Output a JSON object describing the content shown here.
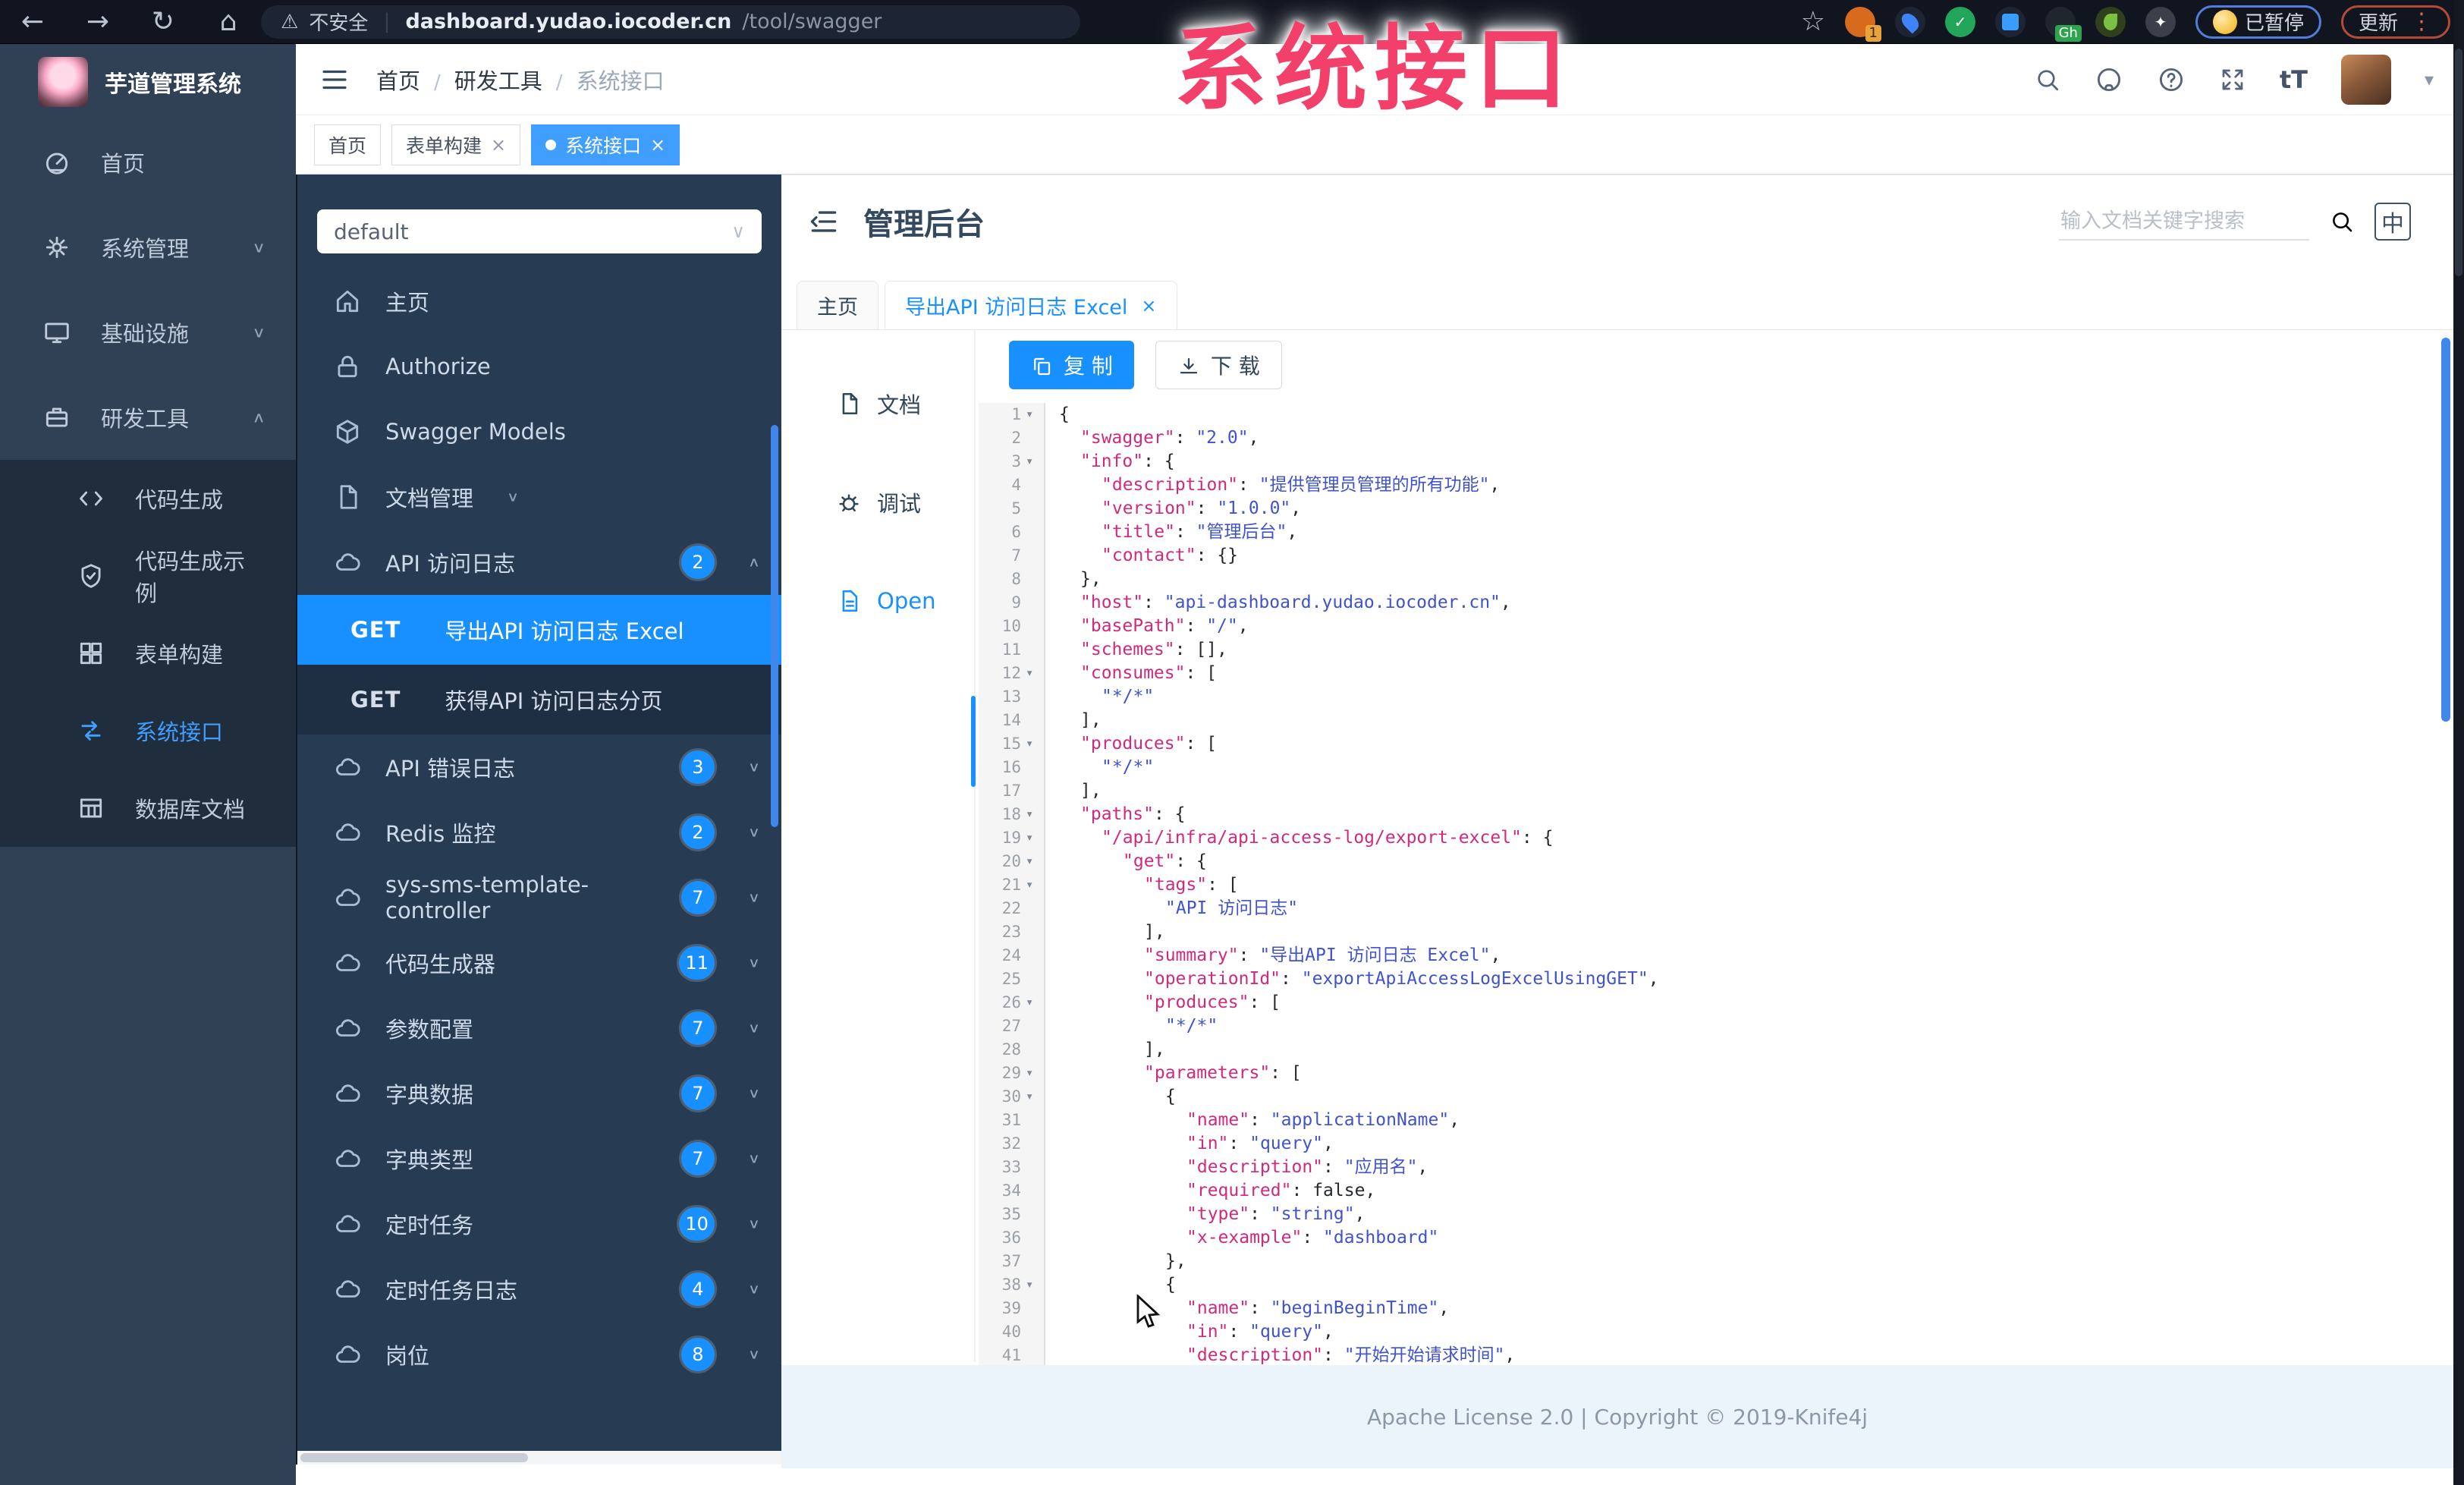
{
  "watermark": "系统接口",
  "browser": {
    "back_icon": "←",
    "forward_icon": "→",
    "reload_icon": "↻",
    "home_icon": "⌂",
    "warning_icon": "⚠",
    "security_label": "不安全",
    "url_host": "dashboard.yudao.iocoder.cn",
    "url_path": "/tool/swagger",
    "bookmark_icon": "☆",
    "extension_badge": "1",
    "gh_badge": "Gh",
    "paused_label": "已暂停",
    "update_label": "更新",
    "kebab_icon": "⋮"
  },
  "app": {
    "logo_title": "芋道管理系统",
    "breadcrumb": [
      {
        "label": "首页",
        "current": false
      },
      {
        "label": "研发工具",
        "current": false
      },
      {
        "label": "系统接口",
        "current": true
      }
    ],
    "sidebar_menu": [
      {
        "label": "首页",
        "icon": "dashboard-icon"
      },
      {
        "label": "系统管理",
        "icon": "gear-icon",
        "chevron": "down"
      },
      {
        "label": "基础设施",
        "icon": "monitor-icon",
        "chevron": "down"
      },
      {
        "label": "研发工具",
        "icon": "toolbox-icon",
        "chevron": "up",
        "expanded": true,
        "children": [
          {
            "label": "代码生成",
            "icon": "code-icon"
          },
          {
            "label": "代码生成示例",
            "icon": "shield-icon"
          },
          {
            "label": "表单构建",
            "icon": "form-icon"
          },
          {
            "label": "系统接口",
            "icon": "api-icon",
            "active": true
          },
          {
            "label": "数据库文档",
            "icon": "database-icon"
          }
        ]
      }
    ],
    "tags": [
      {
        "label": "首页",
        "closable": false,
        "active": false
      },
      {
        "label": "表单构建",
        "closable": true,
        "active": false
      },
      {
        "label": "系统接口",
        "closable": true,
        "active": true
      }
    ]
  },
  "knife4j": {
    "group_selected": "default",
    "menu": [
      {
        "label": "主页",
        "icon": "home-icon"
      },
      {
        "label": "Authorize",
        "icon": "lock-icon"
      },
      {
        "label": "Swagger Models",
        "icon": "cube-icon"
      },
      {
        "label": "文档管理",
        "icon": "doc-icon",
        "chevron": "down"
      },
      {
        "label": "API 访问日志",
        "icon": "cloud-icon",
        "badge": "2",
        "chevron": "up",
        "expanded": true,
        "children": [
          {
            "method": "GET",
            "label": "导出API 访问日志 Excel",
            "active": true
          },
          {
            "method": "GET",
            "label": "获得API 访问日志分页",
            "active": false
          }
        ]
      },
      {
        "label": "API 错误日志",
        "icon": "cloud-icon",
        "badge": "3",
        "chevron": "down"
      },
      {
        "label": "Redis 监控",
        "icon": "cloud-icon",
        "badge": "2",
        "chevron": "down"
      },
      {
        "label": "sys-sms-template-controller",
        "icon": "cloud-icon",
        "badge": "7",
        "chevron": "down"
      },
      {
        "label": "代码生成器",
        "icon": "cloud-icon",
        "badge": "11",
        "chevron": "down"
      },
      {
        "label": "参数配置",
        "icon": "cloud-icon",
        "badge": "7",
        "chevron": "down"
      },
      {
        "label": "字典数据",
        "icon": "cloud-icon",
        "badge": "7",
        "chevron": "down"
      },
      {
        "label": "字典类型",
        "icon": "cloud-icon",
        "badge": "7",
        "chevron": "down"
      },
      {
        "label": "定时任务",
        "icon": "cloud-icon",
        "badge": "10",
        "chevron": "down"
      },
      {
        "label": "定时任务日志",
        "icon": "cloud-icon",
        "badge": "4",
        "chevron": "down"
      },
      {
        "label": "岗位",
        "icon": "cloud-icon",
        "badge": "8",
        "chevron": "down"
      }
    ],
    "main": {
      "title": "管理后台",
      "search_placeholder": "输入文档关键字搜索",
      "lang_icon_label": "中",
      "doc_tabs": [
        {
          "label": "主页",
          "closable": false,
          "active": false
        },
        {
          "label": "导出API 访问日志 Excel",
          "closable": true,
          "active": true
        }
      ],
      "side_tabs": [
        {
          "label": "文档",
          "icon": "doc-icon",
          "active": false
        },
        {
          "label": "调试",
          "icon": "bug-icon",
          "active": false
        },
        {
          "label": "Open",
          "icon": "file-icon",
          "active": true
        }
      ],
      "toolbar": {
        "copy_label": "复 制",
        "download_label": "下 载"
      },
      "footer": "Apache License 2.0 | Copyright © 2019-Knife4j"
    },
    "code_lines": [
      {
        "n": 1,
        "i": 0,
        "f": true,
        "s": [
          [
            "p",
            "{"
          ]
        ]
      },
      {
        "n": 2,
        "i": 1,
        "f": false,
        "s": [
          [
            "k",
            "\"swagger\""
          ],
          [
            "p",
            ": "
          ],
          [
            "s",
            "\"2.0\""
          ],
          [
            "p",
            ","
          ]
        ]
      },
      {
        "n": 3,
        "i": 1,
        "f": true,
        "s": [
          [
            "k",
            "\"info\""
          ],
          [
            "p",
            ": {"
          ]
        ]
      },
      {
        "n": 4,
        "i": 2,
        "f": false,
        "s": [
          [
            "k",
            "\"description\""
          ],
          [
            "p",
            ": "
          ],
          [
            "s",
            "\"提供管理员管理的所有功能\""
          ],
          [
            "p",
            ","
          ]
        ]
      },
      {
        "n": 5,
        "i": 2,
        "f": false,
        "s": [
          [
            "k",
            "\"version\""
          ],
          [
            "p",
            ": "
          ],
          [
            "s",
            "\"1.0.0\""
          ],
          [
            "p",
            ","
          ]
        ]
      },
      {
        "n": 6,
        "i": 2,
        "f": false,
        "s": [
          [
            "k",
            "\"title\""
          ],
          [
            "p",
            ": "
          ],
          [
            "s",
            "\"管理后台\""
          ],
          [
            "p",
            ","
          ]
        ]
      },
      {
        "n": 7,
        "i": 2,
        "f": false,
        "s": [
          [
            "k",
            "\"contact\""
          ],
          [
            "p",
            ": {}"
          ]
        ]
      },
      {
        "n": 8,
        "i": 1,
        "f": false,
        "s": [
          [
            "p",
            "},"
          ]
        ]
      },
      {
        "n": 9,
        "i": 1,
        "f": false,
        "s": [
          [
            "k",
            "\"host\""
          ],
          [
            "p",
            ": "
          ],
          [
            "s",
            "\"api-dashboard.yudao.iocoder.cn\""
          ],
          [
            "p",
            ","
          ]
        ]
      },
      {
        "n": 10,
        "i": 1,
        "f": false,
        "s": [
          [
            "k",
            "\"basePath\""
          ],
          [
            "p",
            ": "
          ],
          [
            "s",
            "\"/\""
          ],
          [
            "p",
            ","
          ]
        ]
      },
      {
        "n": 11,
        "i": 1,
        "f": false,
        "s": [
          [
            "k",
            "\"schemes\""
          ],
          [
            "p",
            ": [],"
          ]
        ]
      },
      {
        "n": 12,
        "i": 1,
        "f": true,
        "s": [
          [
            "k",
            "\"consumes\""
          ],
          [
            "p",
            ": ["
          ]
        ]
      },
      {
        "n": 13,
        "i": 2,
        "f": false,
        "s": [
          [
            "s",
            "\"*/*\""
          ]
        ]
      },
      {
        "n": 14,
        "i": 1,
        "f": false,
        "s": [
          [
            "p",
            "],"
          ]
        ]
      },
      {
        "n": 15,
        "i": 1,
        "f": true,
        "s": [
          [
            "k",
            "\"produces\""
          ],
          [
            "p",
            ": ["
          ]
        ]
      },
      {
        "n": 16,
        "i": 2,
        "f": false,
        "s": [
          [
            "s",
            "\"*/*\""
          ]
        ]
      },
      {
        "n": 17,
        "i": 1,
        "f": false,
        "s": [
          [
            "p",
            "],"
          ]
        ]
      },
      {
        "n": 18,
        "i": 1,
        "f": true,
        "s": [
          [
            "k",
            "\"paths\""
          ],
          [
            "p",
            ": {"
          ]
        ]
      },
      {
        "n": 19,
        "i": 2,
        "f": true,
        "s": [
          [
            "k",
            "\"/api/infra/api-access-log/export-excel\""
          ],
          [
            "p",
            ": {"
          ]
        ]
      },
      {
        "n": 20,
        "i": 3,
        "f": true,
        "s": [
          [
            "k",
            "\"get\""
          ],
          [
            "p",
            ": {"
          ]
        ]
      },
      {
        "n": 21,
        "i": 4,
        "f": true,
        "s": [
          [
            "k",
            "\"tags\""
          ],
          [
            "p",
            ": ["
          ]
        ]
      },
      {
        "n": 22,
        "i": 5,
        "f": false,
        "s": [
          [
            "s",
            "\"API 访问日志\""
          ]
        ]
      },
      {
        "n": 23,
        "i": 4,
        "f": false,
        "s": [
          [
            "p",
            "],"
          ]
        ]
      },
      {
        "n": 24,
        "i": 4,
        "f": false,
        "s": [
          [
            "k",
            "\"summary\""
          ],
          [
            "p",
            ": "
          ],
          [
            "s",
            "\"导出API 访问日志 Excel\""
          ],
          [
            "p",
            ","
          ]
        ]
      },
      {
        "n": 25,
        "i": 4,
        "f": false,
        "s": [
          [
            "k",
            "\"operationId\""
          ],
          [
            "p",
            ": "
          ],
          [
            "s",
            "\"exportApiAccessLogExcelUsingGET\""
          ],
          [
            "p",
            ","
          ]
        ]
      },
      {
        "n": 26,
        "i": 4,
        "f": true,
        "s": [
          [
            "k",
            "\"produces\""
          ],
          [
            "p",
            ": ["
          ]
        ]
      },
      {
        "n": 27,
        "i": 5,
        "f": false,
        "s": [
          [
            "s",
            "\"*/*\""
          ]
        ]
      },
      {
        "n": 28,
        "i": 4,
        "f": false,
        "s": [
          [
            "p",
            "],"
          ]
        ]
      },
      {
        "n": 29,
        "i": 4,
        "f": true,
        "s": [
          [
            "k",
            "\"parameters\""
          ],
          [
            "p",
            ": ["
          ]
        ]
      },
      {
        "n": 30,
        "i": 5,
        "f": true,
        "s": [
          [
            "p",
            "{"
          ]
        ]
      },
      {
        "n": 31,
        "i": 6,
        "f": false,
        "s": [
          [
            "k",
            "\"name\""
          ],
          [
            "p",
            ": "
          ],
          [
            "s",
            "\"applicationName\""
          ],
          [
            "p",
            ","
          ]
        ]
      },
      {
        "n": 32,
        "i": 6,
        "f": false,
        "s": [
          [
            "k",
            "\"in\""
          ],
          [
            "p",
            ": "
          ],
          [
            "s",
            "\"query\""
          ],
          [
            "p",
            ","
          ]
        ]
      },
      {
        "n": 33,
        "i": 6,
        "f": false,
        "s": [
          [
            "k",
            "\"description\""
          ],
          [
            "p",
            ": "
          ],
          [
            "s",
            "\"应用名\""
          ],
          [
            "p",
            ","
          ]
        ]
      },
      {
        "n": 34,
        "i": 6,
        "f": false,
        "s": [
          [
            "k",
            "\"required\""
          ],
          [
            "p",
            ": "
          ],
          [
            "b",
            "false"
          ],
          [
            "p",
            ","
          ]
        ]
      },
      {
        "n": 35,
        "i": 6,
        "f": false,
        "s": [
          [
            "k",
            "\"type\""
          ],
          [
            "p",
            ": "
          ],
          [
            "s",
            "\"string\""
          ],
          [
            "p",
            ","
          ]
        ]
      },
      {
        "n": 36,
        "i": 6,
        "f": false,
        "s": [
          [
            "k",
            "\"x-example\""
          ],
          [
            "p",
            ": "
          ],
          [
            "s",
            "\"dashboard\""
          ]
        ]
      },
      {
        "n": 37,
        "i": 5,
        "f": false,
        "s": [
          [
            "p",
            "},"
          ]
        ]
      },
      {
        "n": 38,
        "i": 5,
        "f": true,
        "s": [
          [
            "p",
            "{"
          ]
        ]
      },
      {
        "n": 39,
        "i": 6,
        "f": false,
        "s": [
          [
            "k",
            "\"name\""
          ],
          [
            "p",
            ": "
          ],
          [
            "s",
            "\"beginBeginTime\""
          ],
          [
            "p",
            ","
          ]
        ]
      },
      {
        "n": 40,
        "i": 6,
        "f": false,
        "s": [
          [
            "k",
            "\"in\""
          ],
          [
            "p",
            ": "
          ],
          [
            "s",
            "\"query\""
          ],
          [
            "p",
            ","
          ]
        ]
      },
      {
        "n": 41,
        "i": 6,
        "f": false,
        "s": [
          [
            "k",
            "\"description\""
          ],
          [
            "p",
            ": "
          ],
          [
            "s",
            "\"开始开始请求时间\""
          ],
          [
            "p",
            ","
          ]
        ]
      }
    ]
  }
}
